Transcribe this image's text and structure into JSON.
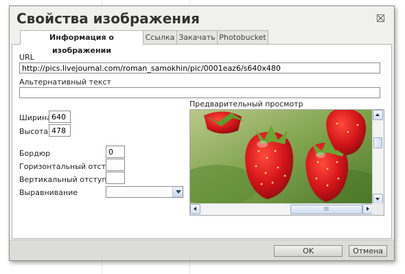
{
  "dialog": {
    "title": "Свойства изображения"
  },
  "tabs": [
    {
      "label": "Информация о изображении",
      "active": true
    },
    {
      "label": "Ссылка",
      "active": false
    },
    {
      "label": "Закачать",
      "active": false
    },
    {
      "label": "Photobucket",
      "active": false
    }
  ],
  "form": {
    "url_label": "URL",
    "url_value": "http://pics.livejournal.com/roman_samokhin/pic/0001eaz6/s640x480",
    "alt_label": "Альтернативный текст",
    "alt_value": "",
    "width_label": "Ширина",
    "width_value": "640",
    "height_label": "Высота",
    "height_value": "478",
    "border_label": "Бордюр",
    "border_value": "0",
    "hspace_label": "Горизонтальный отступ",
    "hspace_value": "",
    "vspace_label": "Вертикальный отступ",
    "vspace_value": "",
    "align_label": "Выравнивание",
    "align_value": ""
  },
  "preview": {
    "label": "Предварительный просмотр",
    "scroll_grip": "III"
  },
  "buttons": {
    "ok": "OK",
    "cancel": "Отмена"
  },
  "colors": {
    "dialog_bg": "#f0f0ee",
    "footer_bg": "#dcdcda",
    "scrollbar_accent": "#c9d8ef"
  },
  "icons": {
    "close": "close-icon",
    "dropdown": "chevron-down-icon",
    "scroll_up": "arrow-up-icon",
    "scroll_down": "arrow-down-icon",
    "scroll_left": "arrow-left-icon",
    "scroll_right": "arrow-right-icon"
  }
}
